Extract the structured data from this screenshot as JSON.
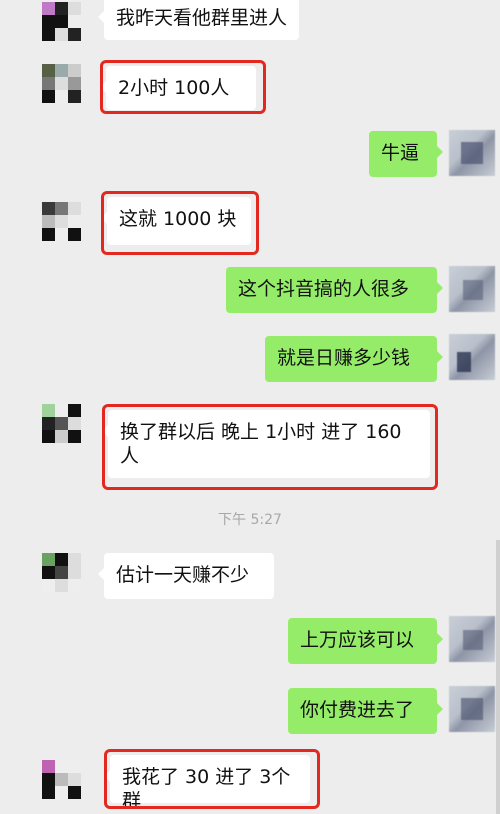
{
  "messages": [
    {
      "side": "left",
      "text": "我昨天看他群里进人"
    },
    {
      "side": "left",
      "text": "2小时 100人"
    },
    {
      "side": "right",
      "text": "牛逼"
    },
    {
      "side": "left",
      "text": "这就 1000 块"
    },
    {
      "side": "right",
      "text": "这个抖音搞的人很多"
    },
    {
      "side": "right",
      "text": "就是日赚多少钱"
    },
    {
      "side": "left",
      "text": "换了群以后  晚上  1小时  进了 160 人"
    },
    {
      "side": "left",
      "text": "估计一天赚不少"
    },
    {
      "side": "right",
      "text": "上万应该可以"
    },
    {
      "side": "right",
      "text": "你付费进去了"
    },
    {
      "side": "left",
      "text": "我花了 30 进了 3个群"
    }
  ],
  "timestamp": "下午 5:27",
  "colors": {
    "highlight": "#e3291f",
    "right_bubble": "#95ec69",
    "left_bubble": "#ffffff",
    "background": "#ededed"
  }
}
